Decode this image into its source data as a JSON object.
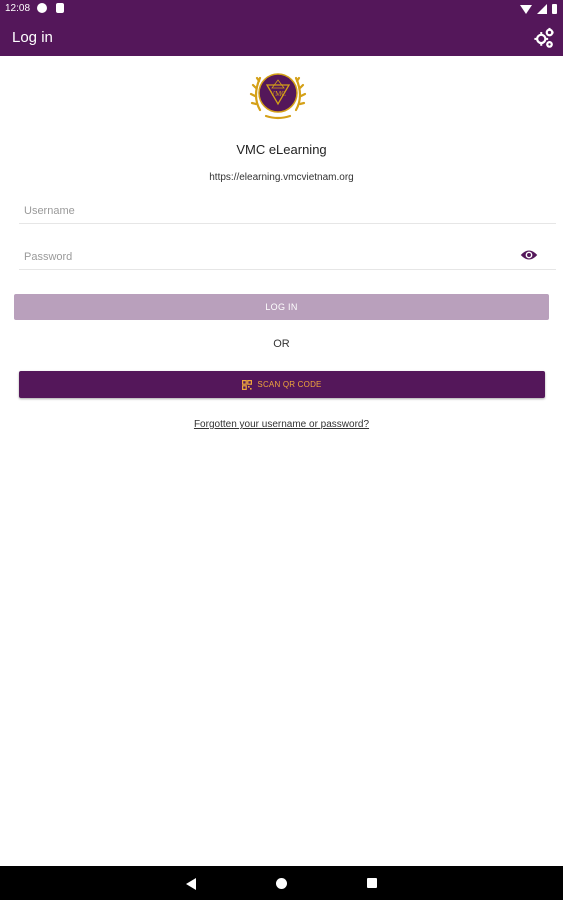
{
  "status_bar": {
    "time": "12:08"
  },
  "app_bar": {
    "title": "Log in",
    "settings_icon": "settings-gears-icon"
  },
  "site": {
    "name": "VMC eLearning",
    "url": "https://elearning.vmcvietnam.org",
    "logo_text": "VMC"
  },
  "form": {
    "username_placeholder": "Username",
    "username_value": "",
    "password_placeholder": "Password",
    "password_value": "",
    "login_label": "LOG IN",
    "or_text": "OR",
    "scan_label": "SCAN QR CODE",
    "forgot_label": "Forgotten your username or password?"
  },
  "colors": {
    "brand": "#54175a",
    "login_disabled": "#b9a0bc",
    "scan_text": "#f0a73c",
    "logo_gold": "#d4a017"
  }
}
